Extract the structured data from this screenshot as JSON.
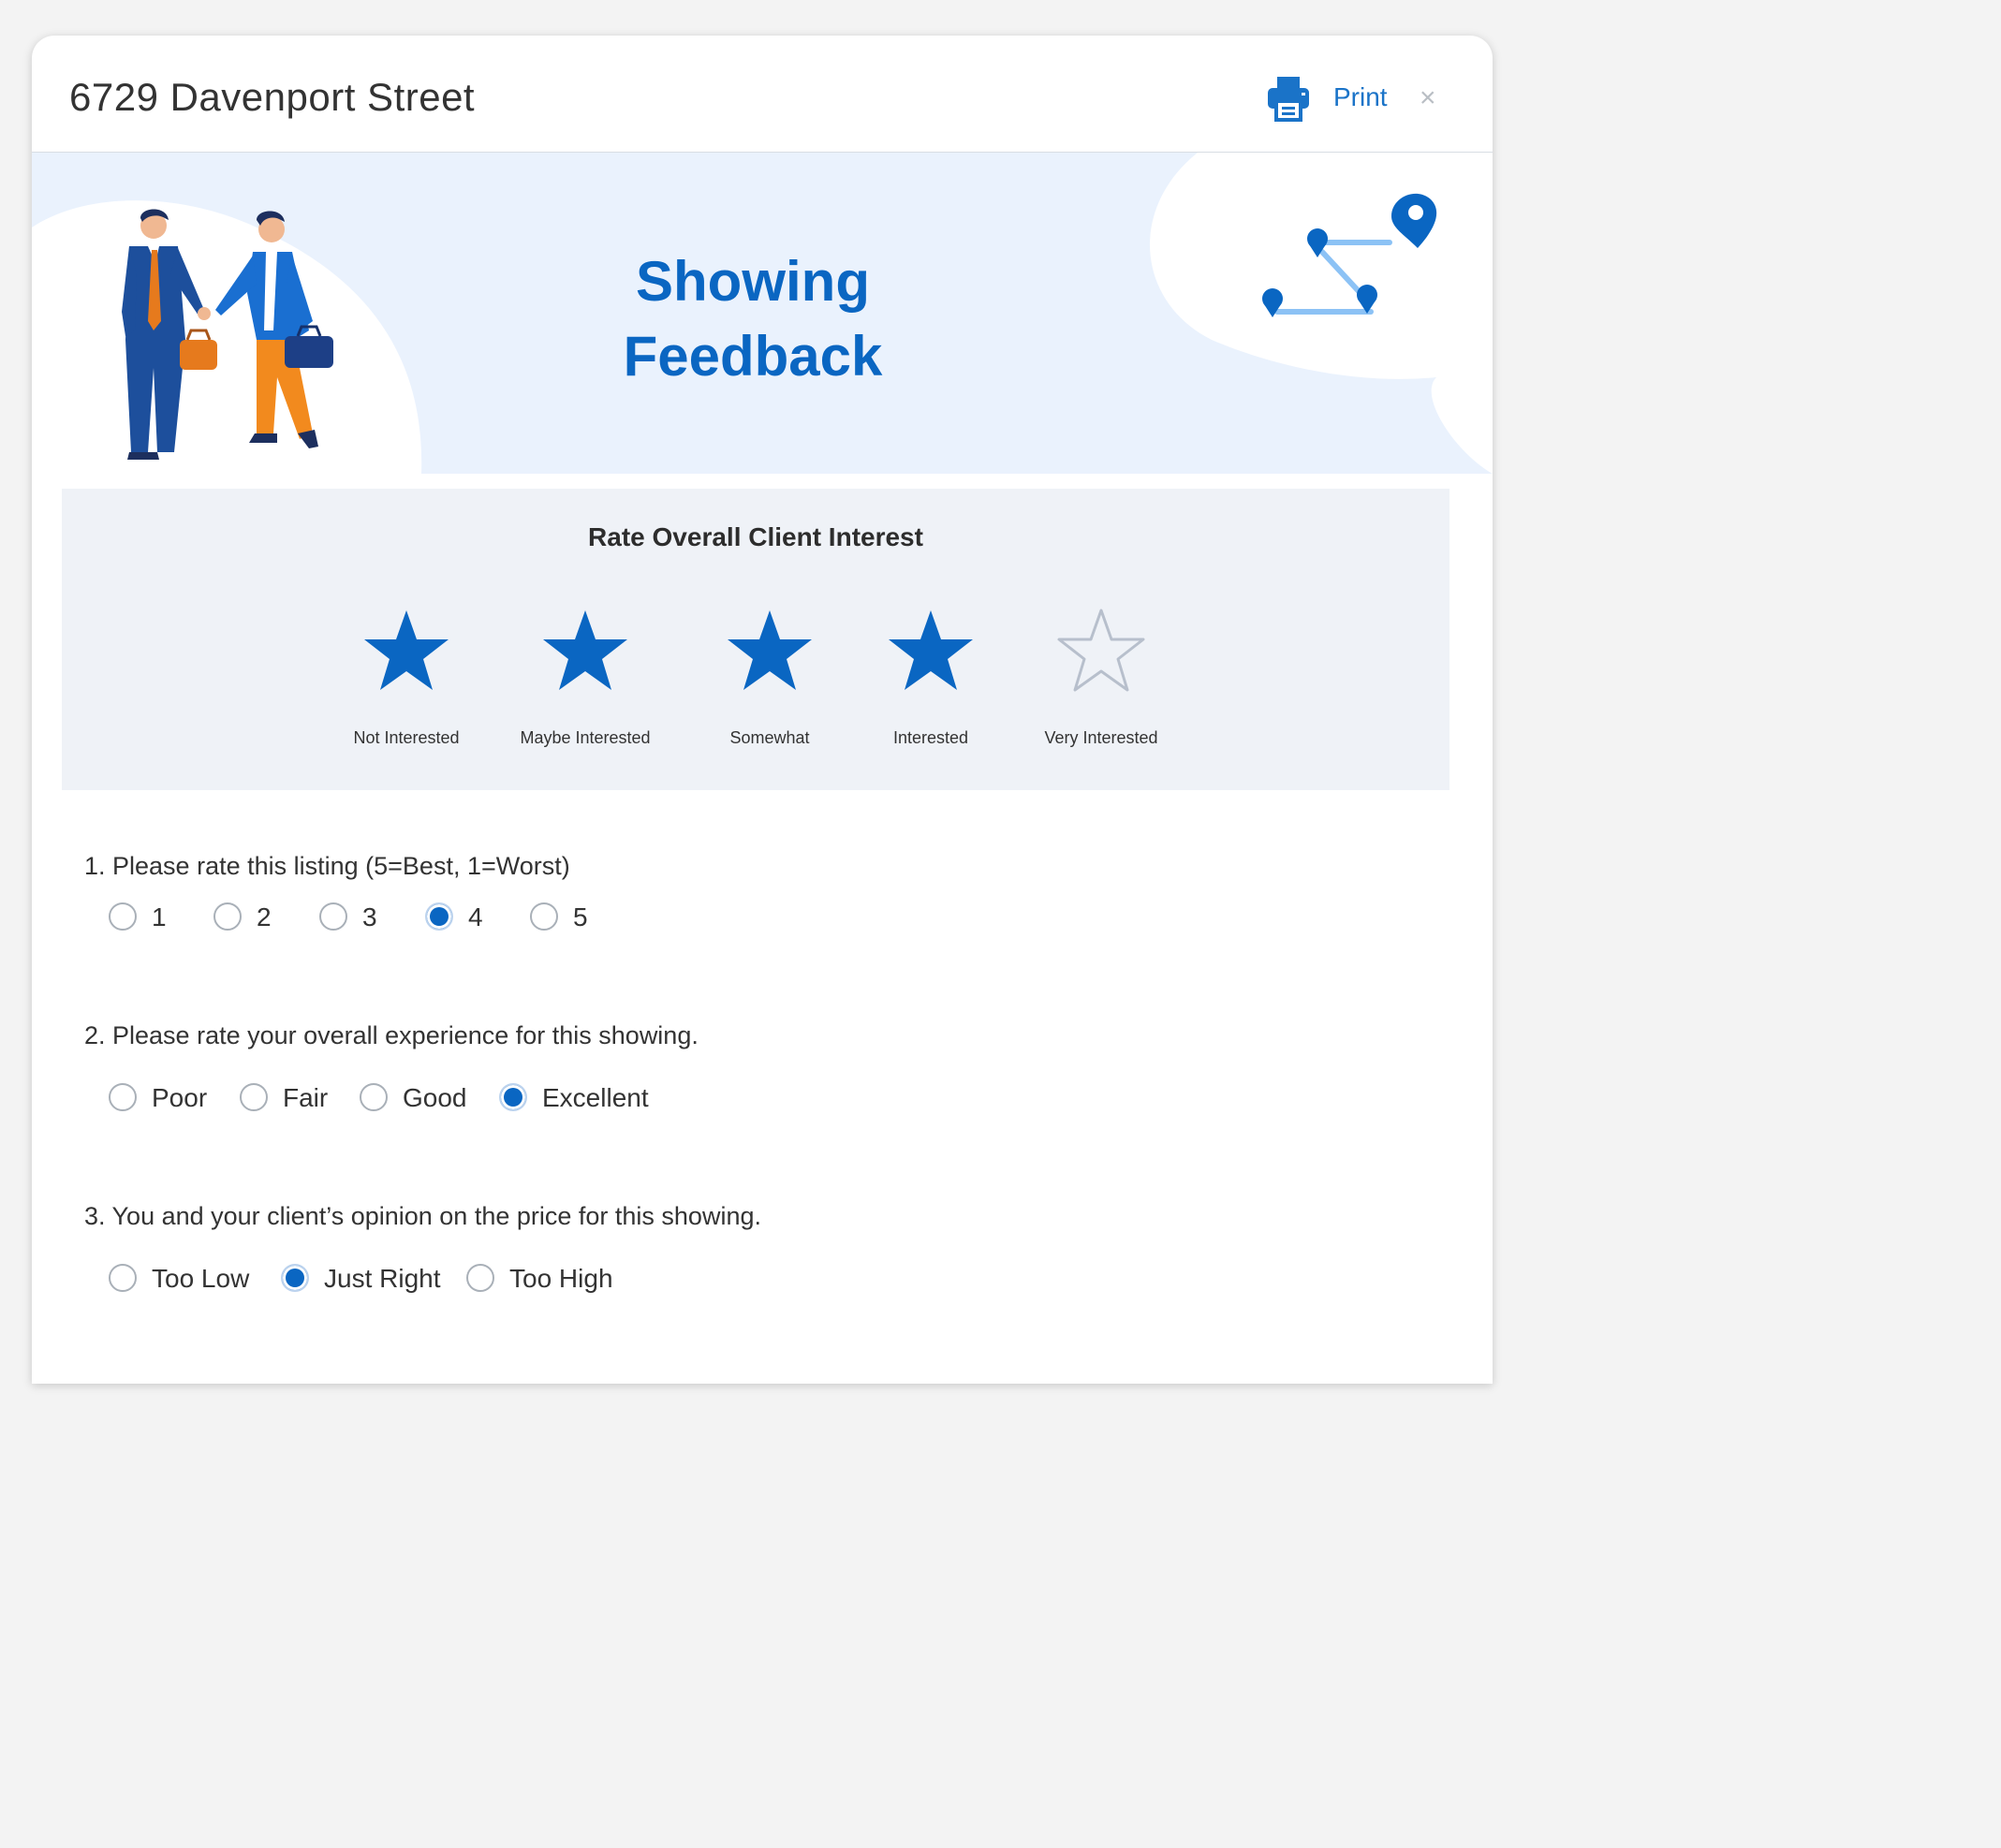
{
  "header": {
    "title": "6729 Davenport Street",
    "print_label": "Print",
    "close_glyph": "×"
  },
  "banner": {
    "title_line1": "Showing",
    "title_line2": "Feedback"
  },
  "interest": {
    "title": "Rate Overall Client Interest",
    "selected_count": 4,
    "options": [
      {
        "label": "Not Interested"
      },
      {
        "label": "Maybe Interested"
      },
      {
        "label": "Somewhat"
      },
      {
        "label": "Interested"
      },
      {
        "label": "Very Interested"
      }
    ]
  },
  "questions": [
    {
      "text": "1. Please rate this listing (5=Best, 1=Worst)",
      "selected": "4",
      "options": [
        "1",
        "2",
        "3",
        "4",
        "5"
      ]
    },
    {
      "text": "2. Please rate your overall experience for this showing.",
      "selected": "Excellent",
      "options": [
        "Poor",
        "Fair",
        "Good",
        "Excellent"
      ]
    },
    {
      "text": "3. You and your client’s opinion on the price for this showing.",
      "selected": "Just Right",
      "options": [
        "Too Low",
        "Just Right",
        "Too High"
      ]
    }
  ],
  "colors": {
    "accent": "#0a66c2",
    "star_empty": "#b7bfcc",
    "banner_bg": "#eaf2fd"
  }
}
